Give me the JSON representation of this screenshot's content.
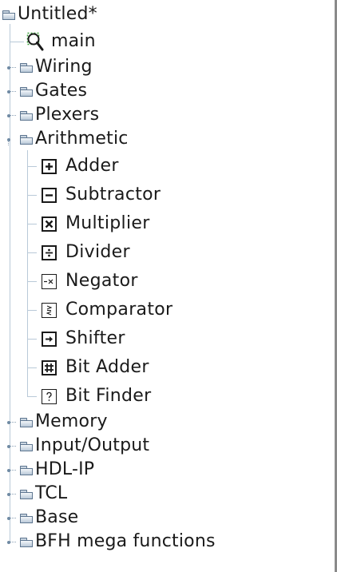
{
  "tree": {
    "root": {
      "label": "Untitled*",
      "icon": "folder-icon"
    },
    "circuit": {
      "label": "main",
      "icon": "magnifier-icon"
    },
    "categories": [
      {
        "label": "Wiring",
        "icon": "folder-icon"
      },
      {
        "label": "Gates",
        "icon": "folder-icon"
      },
      {
        "label": "Plexers",
        "icon": "folder-icon"
      },
      {
        "label": "Arithmetic",
        "icon": "folder-icon",
        "expanded": true
      },
      {
        "label": "Memory",
        "icon": "folder-icon"
      },
      {
        "label": "Input/Output",
        "icon": "folder-icon"
      },
      {
        "label": "HDL-IP",
        "icon": "folder-icon"
      },
      {
        "label": "TCL",
        "icon": "folder-icon"
      },
      {
        "label": "Base",
        "icon": "folder-icon"
      },
      {
        "label": "BFH mega functions",
        "icon": "folder-icon"
      }
    ],
    "arithmetic_items": [
      {
        "label": "Adder",
        "icon": "adder-icon"
      },
      {
        "label": "Subtractor",
        "icon": "subtractor-icon"
      },
      {
        "label": "Multiplier",
        "icon": "multiplier-icon"
      },
      {
        "label": "Divider",
        "icon": "divider-icon"
      },
      {
        "label": "Negator",
        "icon": "negator-icon"
      },
      {
        "label": "Comparator",
        "icon": "comparator-icon"
      },
      {
        "label": "Shifter",
        "icon": "shifter-icon"
      },
      {
        "label": "Bit Adder",
        "icon": "bit-adder-icon"
      },
      {
        "label": "Bit Finder",
        "icon": "bit-finder-icon"
      }
    ]
  },
  "colors": {
    "text": "#1a1a1a",
    "tree_line": "#b9c9d8",
    "folder_border": "#5e7690",
    "magnifier_green": "#3aa03a"
  }
}
